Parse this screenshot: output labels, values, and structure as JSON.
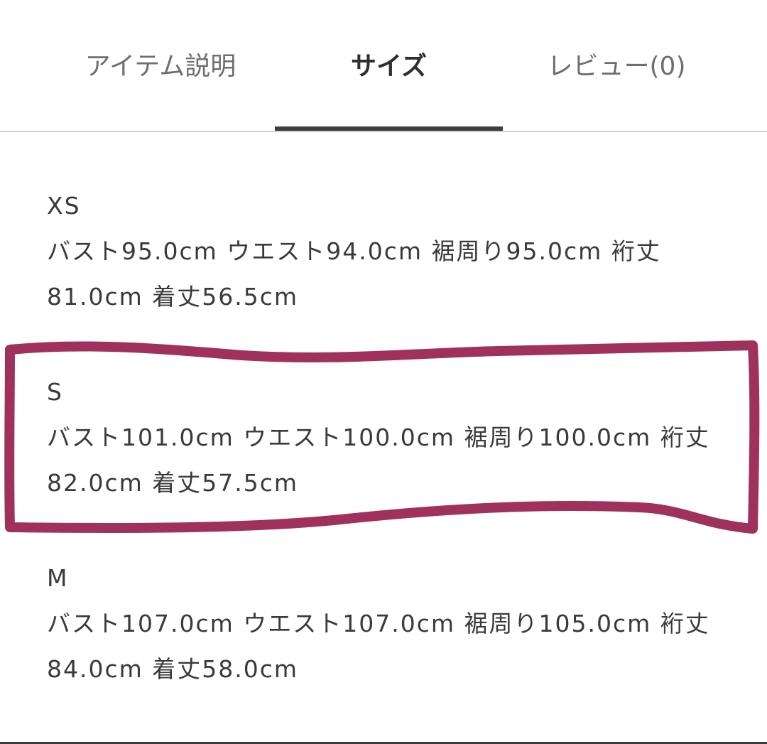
{
  "tabs": [
    {
      "label": "アイテム説明",
      "active": false
    },
    {
      "label": "サイズ",
      "active": true
    },
    {
      "label": "レビュー(0)",
      "active": false
    }
  ],
  "sizes": [
    {
      "name": "XS",
      "spec": "バスト95.0cm ウエスト94.0cm 裾周り95.0cm 裄丈81.0cm 着丈56.5cm"
    },
    {
      "name": "S",
      "spec": "バスト101.0cm ウエスト100.0cm 裾周り100.0cm 裄丈82.0cm 着丈57.5cm"
    },
    {
      "name": "M",
      "spec": "バスト107.0cm ウエスト107.0cm 裾周り105.0cm 裄丈84.0cm 着丈58.0cm"
    }
  ],
  "highlight": {
    "color": "#a0305c",
    "target": "S"
  }
}
